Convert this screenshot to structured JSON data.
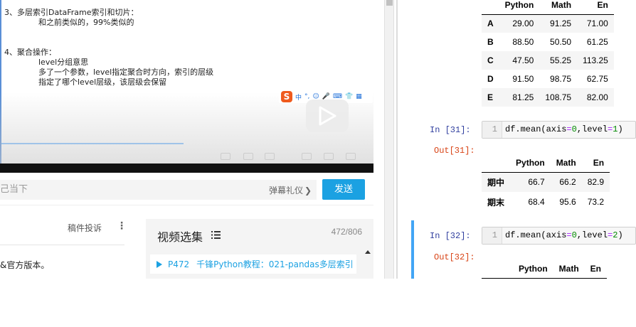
{
  "video": {
    "notes": [
      "3、多层索引DataFrame索引和切片：",
      "和之前类似的，99%类似的",
      "4、聚合操作：",
      "level分组意思",
      "多了一个参数，level指定聚合时方向，索引的层级",
      "指定了哪个level层级，该层级会保留"
    ],
    "ime_icons": [
      "中",
      "°,",
      "☺",
      "🎤",
      "⌨",
      "👕",
      "▦"
    ]
  },
  "danmaku": {
    "placeholder": "己当下",
    "etiquette_label": "弹幕礼仪",
    "send_label": "发送"
  },
  "below_video": {
    "report_label": "稿件投诉",
    "description": "&官方版本。"
  },
  "playlist": {
    "title": "视频选集",
    "count": "472/806",
    "current_item": {
      "number": "P472",
      "title": "千锋Python教程：021-pandas多层索引"
    }
  },
  "notebook": {
    "top_table": {
      "columns": [
        "Python",
        "Math",
        "En"
      ],
      "rows": [
        {
          "index": "A",
          "values": [
            "29.00",
            "91.25",
            "71.00"
          ]
        },
        {
          "index": "B",
          "values": [
            "88.50",
            "50.50",
            "61.25"
          ]
        },
        {
          "index": "C",
          "values": [
            "47.50",
            "55.25",
            "113.25"
          ]
        },
        {
          "index": "D",
          "values": [
            "91.50",
            "98.75",
            "62.75"
          ]
        },
        {
          "index": "E",
          "values": [
            "81.25",
            "108.75",
            "82.00"
          ]
        }
      ]
    },
    "cell31": {
      "in_prompt": "In  [31]:",
      "line_number": "1",
      "code_prefix": "df.mean(axis",
      "code_eq1": "=",
      "code_num1": "0",
      "code_mid": ",level",
      "code_eq2": "=",
      "code_num2": "1",
      "code_suffix": ")",
      "out_prompt": "Out[31]:",
      "table": {
        "columns": [
          "Python",
          "Math",
          "En"
        ],
        "rows": [
          {
            "index": "期中",
            "values": [
              "66.7",
              "66.2",
              "82.9"
            ]
          },
          {
            "index": "期末",
            "values": [
              "68.4",
              "95.6",
              "73.2"
            ]
          }
        ]
      }
    },
    "cell32": {
      "in_prompt": "In  [32]:",
      "line_number": "1",
      "code_prefix": "df.mean(axis",
      "code_eq1": "=",
      "code_num1": "0",
      "code_mid": ",level",
      "code_eq2": "=",
      "code_num2": "2",
      "code_suffix": ")",
      "out_prompt": "Out[32]:",
      "table": {
        "columns": [
          "Python",
          "Math",
          "En"
        ]
      }
    }
  },
  "colors": {
    "send_button": "#1ba1e2",
    "playlist_link": "#1ba1e2",
    "in_prompt": "#303f9f",
    "out_prompt": "#d84315",
    "active_cell_bar": "#42a5f5"
  }
}
